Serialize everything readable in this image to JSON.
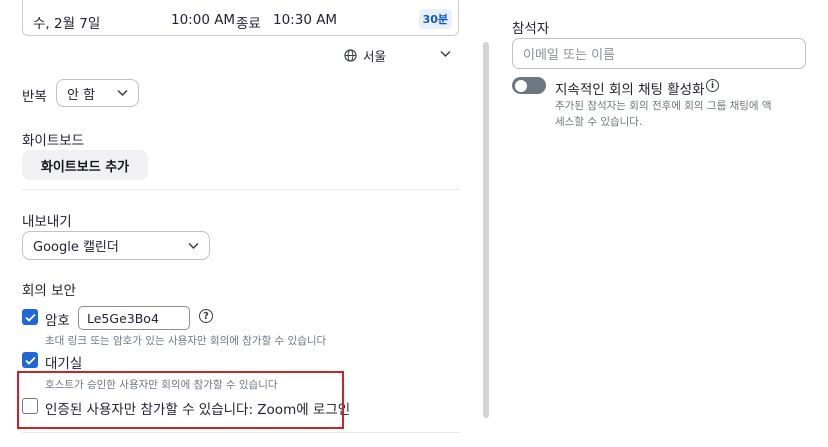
{
  "schedule": {
    "date": "수, 2월 7일",
    "start_time": "10:00 AM",
    "end_label": "종료",
    "end_time": "10:30 AM",
    "duration": "30분",
    "timezone": "서울"
  },
  "recurrence": {
    "label": "반복",
    "value": "안 함"
  },
  "whiteboard": {
    "label": "화이트보드",
    "button": "화이트보드 추가"
  },
  "export": {
    "label": "내보내기",
    "value": "Google 캘린더"
  },
  "security": {
    "label": "회의 보안",
    "passcode": {
      "label": "암호",
      "value": "Le5Ge3Bo4",
      "checked": true,
      "hint": "초대 링크 또는 암호가 있는 사용자만 회의에 참가할 수 있습니다"
    },
    "waiting_room": {
      "label": "대기실",
      "checked": true,
      "hint": "호스트가 승인한 사용자만 회의에 참가할 수 있습니다"
    },
    "auth_only": {
      "label": "인증된 사용자만 참가할 수 있습니다: Zoom에 로그인",
      "checked": false
    }
  },
  "attendees": {
    "label": "참석자",
    "placeholder": "이메일 또는 이름",
    "persistent_chat": {
      "label": "지속적인 회의 채팅 활성화",
      "enabled": false,
      "description_line1": "추가된 참석자는 회의 전후에 회의 그룹 채팅에 액",
      "description_line2": "세스할 수 있습니다."
    }
  },
  "colors": {
    "accent": "#1f66d8",
    "highlight_border": "#c9242b",
    "badge_bg": "#e8f0ff",
    "badge_text": "#0e5ac8"
  }
}
